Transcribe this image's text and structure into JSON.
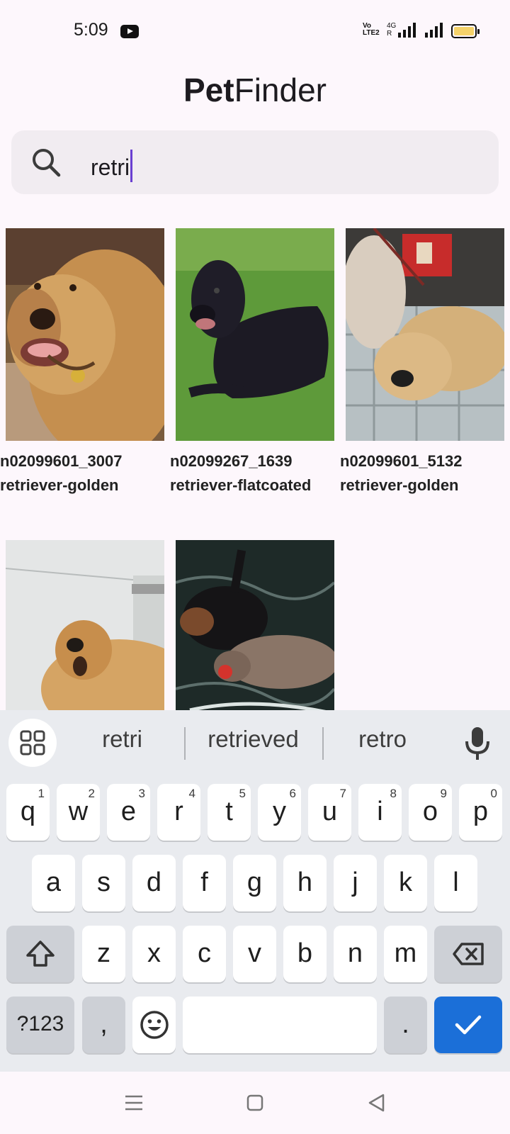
{
  "status_bar": {
    "time": "5:09",
    "volte_line1": "Vo",
    "volte_line2": "LTE2",
    "net_line1": "4G",
    "net_line2": "R"
  },
  "header": {
    "title_bold": "Pet",
    "title_regular": "Finder"
  },
  "search": {
    "icon": "search-icon",
    "value": "retri"
  },
  "results": [
    {
      "id_text": "n02099601_3007",
      "breed": "retriever-golden"
    },
    {
      "id_text": "n02099267_1639",
      "breed": "retriever-flatcoated"
    },
    {
      "id_text": "n02099601_5132",
      "breed": "retriever-golden"
    },
    {
      "id_text": "",
      "breed": ""
    },
    {
      "id_text": "",
      "breed": ""
    }
  ],
  "keyboard": {
    "suggestions": [
      "retri",
      "retrieved",
      "retro"
    ],
    "row1": [
      {
        "k": "q",
        "h": "1"
      },
      {
        "k": "w",
        "h": "2"
      },
      {
        "k": "e",
        "h": "3"
      },
      {
        "k": "r",
        "h": "4"
      },
      {
        "k": "t",
        "h": "5"
      },
      {
        "k": "y",
        "h": "6"
      },
      {
        "k": "u",
        "h": "7"
      },
      {
        "k": "i",
        "h": "8"
      },
      {
        "k": "o",
        "h": "9"
      },
      {
        "k": "p",
        "h": "0"
      }
    ],
    "row2": [
      "a",
      "s",
      "d",
      "f",
      "g",
      "h",
      "j",
      "k",
      "l"
    ],
    "row3": [
      "z",
      "x",
      "c",
      "v",
      "b",
      "n",
      "m"
    ],
    "symbols_label": "?123",
    "comma": ",",
    "period": ".",
    "accent_color": "#1b6fd8"
  },
  "colors": {
    "background": "#fdf7fc",
    "search_bg": "#f1ecf1",
    "caret": "#6a3fd1"
  }
}
